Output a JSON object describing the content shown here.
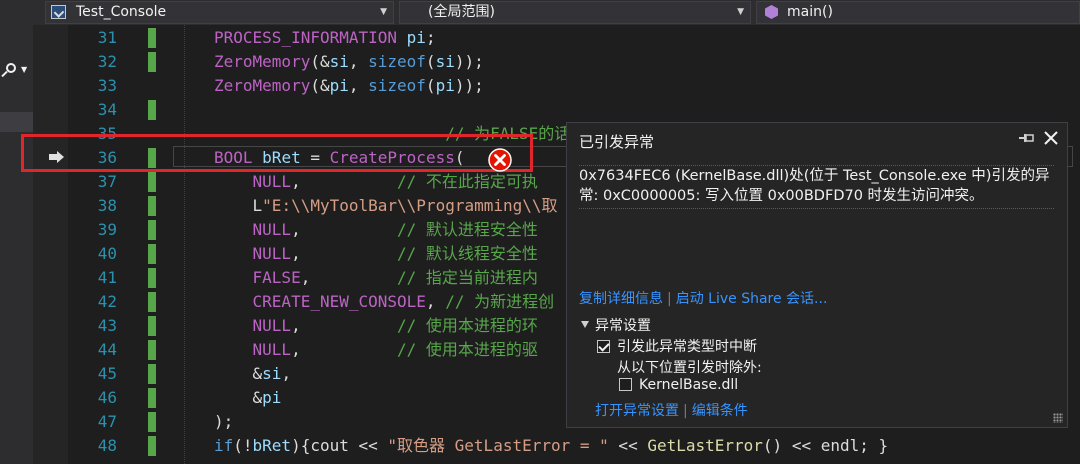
{
  "navbar": {
    "project": "Test_Console",
    "scope": "(全局范围)",
    "member": "main()"
  },
  "editor": {
    "line_numbers": [
      "31",
      "32",
      "33",
      "34",
      "35",
      "36",
      "37",
      "38",
      "39",
      "40",
      "41",
      "42",
      "43",
      "44",
      "45",
      "46",
      "47",
      "48"
    ],
    "lines": [
      [
        {
          "t": "PROCESS_INFORMATION",
          "c": "macro"
        },
        {
          "t": " ",
          "c": ""
        },
        {
          "t": "pi",
          "c": "var"
        },
        {
          "t": ";",
          "c": ""
        }
      ],
      [
        {
          "t": "ZeroMemory",
          "c": "macro"
        },
        {
          "t": "(&",
          "c": ""
        },
        {
          "t": "si",
          "c": "var"
        },
        {
          "t": ", ",
          "c": ""
        },
        {
          "t": "sizeof",
          "c": "kw"
        },
        {
          "t": "(",
          "c": ""
        },
        {
          "t": "si",
          "c": "var"
        },
        {
          "t": "));",
          "c": ""
        }
      ],
      [
        {
          "t": "ZeroMemory",
          "c": "macro"
        },
        {
          "t": "(&",
          "c": ""
        },
        {
          "t": "pi",
          "c": "var"
        },
        {
          "t": ", ",
          "c": ""
        },
        {
          "t": "sizeof",
          "c": "kw"
        },
        {
          "t": "(",
          "c": ""
        },
        {
          "t": "pi",
          "c": "var"
        },
        {
          "t": "));",
          "c": ""
        }
      ],
      [],
      [
        {
          "t": "                        // 为FALSE的话则",
          "c": "cm"
        }
      ],
      [
        {
          "t": "BOOL",
          "c": "macro"
        },
        {
          "t": " ",
          "c": ""
        },
        {
          "t": "bRet",
          "c": "var"
        },
        {
          "t": " = ",
          "c": ""
        },
        {
          "t": "CreateProcess",
          "c": "macro"
        },
        {
          "t": "(",
          "c": ""
        }
      ],
      [
        {
          "t": "    NULL",
          "c": "macro"
        },
        {
          "t": ",          ",
          "c": ""
        },
        {
          "t": "// 不在此指定可执",
          "c": "cm"
        }
      ],
      [
        {
          "t": "    L",
          "c": ""
        },
        {
          "t": "\"E:\\\\MyToolBar\\\\Programming\\\\取",
          "c": "str"
        }
      ],
      [
        {
          "t": "    NULL",
          "c": "macro"
        },
        {
          "t": ",          ",
          "c": ""
        },
        {
          "t": "// 默认进程安全性",
          "c": "cm"
        }
      ],
      [
        {
          "t": "    NULL",
          "c": "macro"
        },
        {
          "t": ",          ",
          "c": ""
        },
        {
          "t": "// 默认线程安全性",
          "c": "cm"
        }
      ],
      [
        {
          "t": "    FALSE",
          "c": "macro"
        },
        {
          "t": ",         ",
          "c": ""
        },
        {
          "t": "// 指定当前进程内",
          "c": "cm"
        }
      ],
      [
        {
          "t": "    CREATE_NEW_CONSOLE",
          "c": "macro"
        },
        {
          "t": ", ",
          "c": ""
        },
        {
          "t": "// 为新进程创",
          "c": "cm"
        }
      ],
      [
        {
          "t": "    NULL",
          "c": "macro"
        },
        {
          "t": ",          ",
          "c": ""
        },
        {
          "t": "// 使用本进程的环",
          "c": "cm"
        }
      ],
      [
        {
          "t": "    NULL",
          "c": "macro"
        },
        {
          "t": ",          ",
          "c": ""
        },
        {
          "t": "// 使用本进程的驱",
          "c": "cm"
        }
      ],
      [
        {
          "t": "    &",
          "c": ""
        },
        {
          "t": "si",
          "c": "var"
        },
        {
          "t": ",",
          "c": ""
        }
      ],
      [
        {
          "t": "    &",
          "c": ""
        },
        {
          "t": "pi",
          "c": "var"
        }
      ],
      [
        {
          "t": ");",
          "c": ""
        }
      ],
      [
        {
          "t": "if",
          "c": "kw"
        },
        {
          "t": "(!",
          "c": ""
        },
        {
          "t": "bRet",
          "c": "var"
        },
        {
          "t": "){",
          "c": ""
        },
        {
          "t": "cout",
          "c": ""
        },
        {
          "t": " << ",
          "c": ""
        },
        {
          "t": "\"取色器 GetLastError = \"",
          "c": "str"
        },
        {
          "t": " << ",
          "c": ""
        },
        {
          "t": "GetLastError",
          "c": "fn"
        },
        {
          "t": "() << ",
          "c": ""
        },
        {
          "t": "endl",
          "c": ""
        },
        {
          "t": "; }",
          "c": ""
        }
      ]
    ]
  },
  "exception": {
    "title": "已引发异常",
    "message": "0x7634FEC6 (KernelBase.dll)处(位于 Test_Console.exe 中)引发的异常: 0xC0000005: 写入位置 0x00BDFD70 时发生访问冲突。",
    "link_copy": "复制详细信息",
    "link_liveshare": "启动 Live Share 会话...",
    "settings_header": "异常设置",
    "option_break": "引发此异常类型时中断",
    "option_except": "从以下位置引发时除外:",
    "option_module": "KernelBase.dll",
    "link_open_settings": "打开异常设置",
    "link_edit_conditions": "编辑条件"
  },
  "colors": {
    "accent_red": "#e0262b",
    "error_red": "#e51400",
    "link_blue": "#3794ff",
    "change_green": "#57a64a"
  }
}
